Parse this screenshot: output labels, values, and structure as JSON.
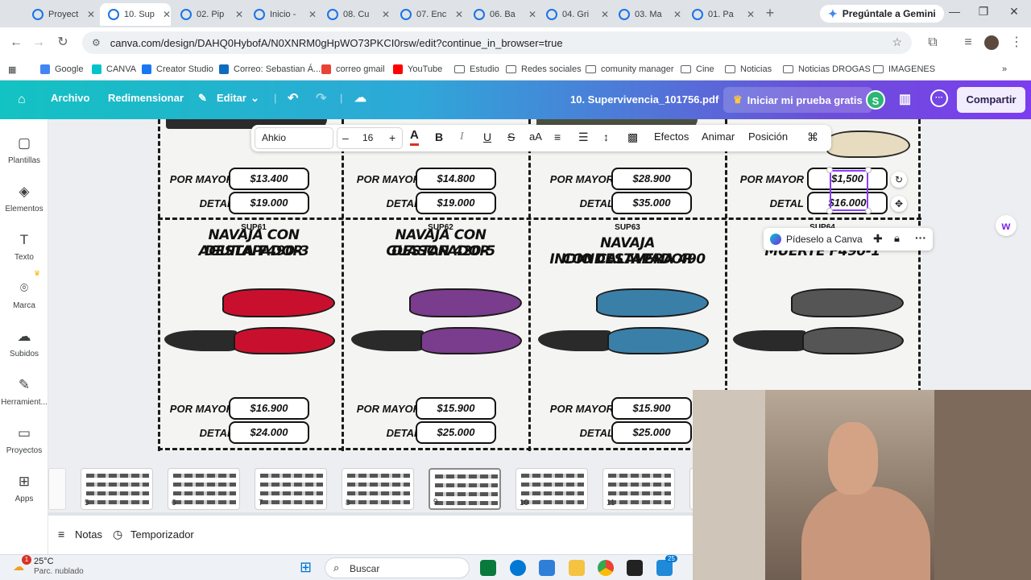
{
  "browser": {
    "tabs": [
      {
        "title": "Proyect",
        "active": false
      },
      {
        "title": "10. Sup",
        "active": true
      },
      {
        "title": "02. Pip",
        "active": false
      },
      {
        "title": "Inicio -",
        "active": false
      },
      {
        "title": "08. Cu",
        "active": false
      },
      {
        "title": "07. Enc",
        "active": false
      },
      {
        "title": "06. Ba",
        "active": false
      },
      {
        "title": "04. Gri",
        "active": false
      },
      {
        "title": "03. Ma",
        "active": false
      },
      {
        "title": "01. Pa",
        "active": false
      }
    ],
    "new_tab": "+",
    "gemini_label": "Pregúntale a Gemini",
    "url": "canva.com/design/DAHQ0HybofA/N0XNRM0gHpWO73PKCI0rsw/edit?continue_in_browser=true",
    "bookmarks": [
      {
        "label": "Google",
        "icon": "google-icon",
        "color": "#4285f4"
      },
      {
        "label": "CANVA",
        "icon": "canva-icon",
        "color": "#00c4cc"
      },
      {
        "label": "Creator Studio",
        "icon": "facebook-icon",
        "color": "#1877f2"
      },
      {
        "label": "Correo: Sebastian Á...",
        "icon": "outlook-icon",
        "color": "#0f6cbd"
      },
      {
        "label": "correo gmail",
        "icon": "gmail-icon",
        "color": "#ea4335"
      },
      {
        "label": "YouTube",
        "icon": "youtube-icon",
        "color": "#ff0000"
      },
      {
        "label": "Estudio",
        "icon": "folder-icon",
        "color": ""
      },
      {
        "label": "Redes sociales",
        "icon": "folder-icon",
        "color": ""
      },
      {
        "label": "comunity manager",
        "icon": "folder-icon",
        "color": ""
      },
      {
        "label": "Cine",
        "icon": "folder-icon",
        "color": ""
      },
      {
        "label": "Noticias",
        "icon": "folder-icon",
        "color": ""
      },
      {
        "label": "Noticias DROGAS",
        "icon": "folder-icon",
        "color": ""
      },
      {
        "label": "IMAGENES",
        "icon": "folder-icon",
        "color": ""
      }
    ]
  },
  "canva": {
    "menu": {
      "archivo": "Archivo",
      "redimensionar": "Redimensionar",
      "editar": "Editar"
    },
    "doc_title": "10. Supervivencia_101756.pdf",
    "trial": "Iniciar mi prueba gratis",
    "avatar_letter": "S",
    "share": "Compartir",
    "sidebar": [
      {
        "label": "Plantillas",
        "icon": "templates-icon"
      },
      {
        "label": "Elementos",
        "icon": "elements-icon"
      },
      {
        "label": "Texto",
        "icon": "text-icon"
      },
      {
        "label": "Marca",
        "icon": "brand-icon"
      },
      {
        "label": "Subidos",
        "icon": "upload-icon"
      },
      {
        "label": "Herramient...",
        "icon": "tools-icon"
      },
      {
        "label": "Proyectos",
        "icon": "projects-icon"
      },
      {
        "label": "Apps",
        "icon": "apps-icon"
      }
    ],
    "text_toolbar": {
      "font": "Ahkio",
      "size": "16",
      "minus": "–",
      "plus": "+",
      "bold": "B",
      "italic": "I",
      "underline": "U",
      "strike": "S",
      "case": "aA",
      "efectos": "Efectos",
      "animar": "Animar",
      "posicion": "Posición"
    },
    "ask_canva": "Pídeselo a Canva",
    "bottom": {
      "notas": "Notas",
      "temporizador": "Temporizador"
    },
    "thumbnails": [
      "5",
      "6",
      "7",
      "8",
      "9",
      "10",
      "11",
      "1"
    ]
  },
  "catalog": {
    "label_por_mayor": "POR MAYOR",
    "label_detal": "DETAL",
    "top_row": [
      {
        "mayor": "$13.400",
        "detal": "$19.000"
      },
      {
        "mayor": "$14.800",
        "detal": "$19.000"
      },
      {
        "mayor": "$28.900",
        "detal": "$35.000"
      },
      {
        "mayor": "$1,500",
        "detal": "$16.000"
      }
    ],
    "products": [
      {
        "code": "SUP61",
        "title_line1": "NAVAJA CON DESTAPADOR",
        "title_line2": "AGUILA F490-3",
        "mayor": "$16.900",
        "detal": "$24.000",
        "knife_color": "#c8102e"
      },
      {
        "code": "SUP62",
        "title_line1": "NAVAJA CON DESTAPADOR",
        "title_line2": "GUASON 420-5",
        "mayor": "$15.900",
        "detal": "$25.000",
        "knife_color": "#7a3c8c"
      },
      {
        "code": "SUP63",
        "title_line1": "NAVAJA CONDESTAPADOR",
        "title_line2": "INDIO CALAVERA 490",
        "mayor": "$15.900",
        "detal": "$25.000",
        "knife_color": "#3a7fa8"
      },
      {
        "code": "SUP64",
        "title_line1": "NAV",
        "title_line2": "MUERTE F490-1",
        "mayor": "",
        "detal": "",
        "knife_color": "#555555"
      }
    ]
  },
  "taskbar": {
    "weather_temp": "25°C",
    "weather_desc": "Parc. nublado",
    "weather_badge": "1",
    "search": "Buscar",
    "chrome_badge": "25"
  }
}
